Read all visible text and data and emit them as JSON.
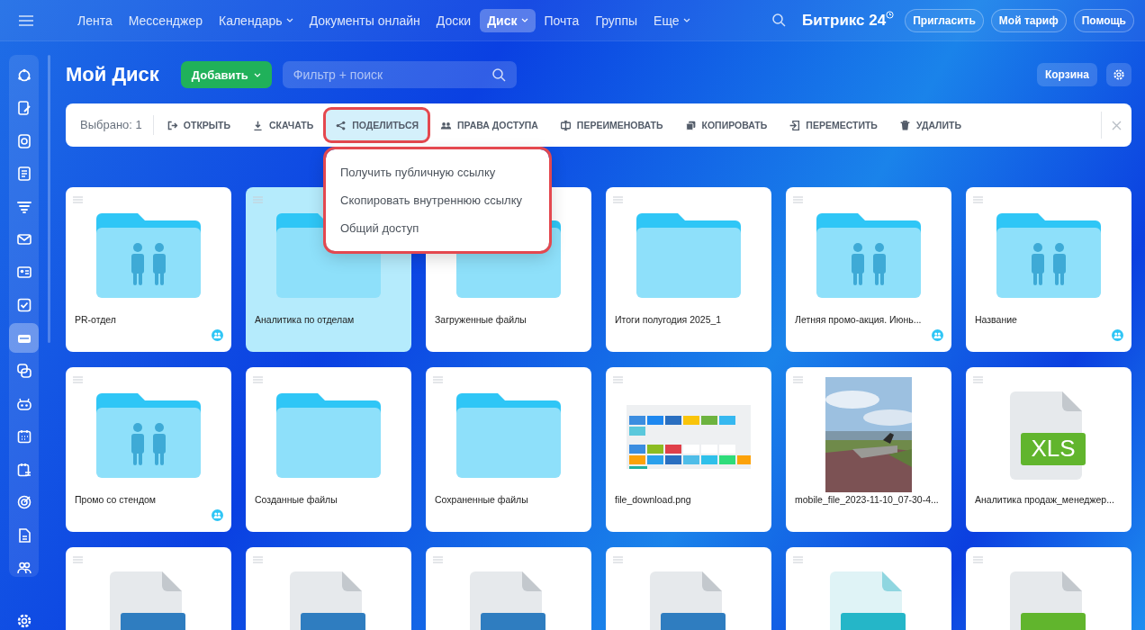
{
  "top_bar": {
    "nav": [
      {
        "label": "Лента",
        "selected": false,
        "dropdown": false
      },
      {
        "label": "Мессенджер",
        "selected": false,
        "dropdown": false
      },
      {
        "label": "Календарь",
        "selected": false,
        "dropdown": true
      },
      {
        "label": "Документы онлайн",
        "selected": false,
        "dropdown": false
      },
      {
        "label": "Доски",
        "selected": false,
        "dropdown": false
      },
      {
        "label": "Диск",
        "selected": true,
        "dropdown": true
      },
      {
        "label": "Почта",
        "selected": false,
        "dropdown": false
      },
      {
        "label": "Группы",
        "selected": false,
        "dropdown": false
      },
      {
        "label": "Еще",
        "selected": false,
        "dropdown": true
      }
    ],
    "logo": "Битрикс 24",
    "buttons": [
      "Пригласить",
      "Мой тариф",
      "Помощь"
    ]
  },
  "sidebar": {
    "items": [
      {
        "selected": false
      },
      {
        "selected": false
      },
      {
        "selected": false
      },
      {
        "selected": false
      },
      {
        "selected": false
      },
      {
        "selected": false
      },
      {
        "selected": false
      },
      {
        "selected": false
      },
      {
        "selected": true
      },
      {
        "selected": false
      },
      {
        "selected": false
      },
      {
        "selected": false
      },
      {
        "selected": false
      },
      {
        "selected": false
      },
      {
        "selected": false
      },
      {
        "selected": false
      }
    ]
  },
  "header": {
    "title": "Мой Диск",
    "add_button": "Добавить",
    "search": {
      "placeholder": "Фильтр + поиск"
    },
    "trash_button": "Корзина"
  },
  "toolbar": {
    "selected_count": "Выбрано: 1",
    "actions": [
      {
        "label": "ОТКРЫТЬ",
        "highlighted": false
      },
      {
        "label": "СКАЧАТЬ",
        "highlighted": false
      },
      {
        "label": "ПОДЕЛИТЬСЯ",
        "highlighted": true
      },
      {
        "label": "ПРАВА ДОСТУПА",
        "highlighted": false
      },
      {
        "label": "ПЕРЕИМЕНОВАТЬ",
        "highlighted": false
      },
      {
        "label": "КОПИРОВАТЬ",
        "highlighted": false
      },
      {
        "label": "ПЕРЕМЕСТИТЬ",
        "highlighted": false
      },
      {
        "label": "УДАЛИТЬ",
        "highlighted": false
      }
    ]
  },
  "share_menu": {
    "highlighted": true,
    "items": [
      "Получить публичную ссылку",
      "Скопировать внутреннюю ссылку",
      "Общий доступ"
    ]
  },
  "files": [
    {
      "kind": "shared-folder",
      "name": "PR-отдел",
      "selected": false,
      "shared": true
    },
    {
      "kind": "folder",
      "name": "Аналитика по отделам",
      "selected": true,
      "shared": false
    },
    {
      "kind": "folder",
      "name": "Загруженные файлы",
      "selected": false,
      "shared": false
    },
    {
      "kind": "folder",
      "name": "Итоги полугодия 2025_1",
      "selected": false,
      "shared": false
    },
    {
      "kind": "shared-folder",
      "name": "Летняя промо-акция. Июнь...",
      "selected": false,
      "shared": true
    },
    {
      "kind": "shared-folder",
      "name": "Название",
      "selected": false,
      "shared": true
    },
    {
      "kind": "shared-folder",
      "name": "Промо со стендом",
      "selected": false,
      "shared": true
    },
    {
      "kind": "folder",
      "name": "Созданные файлы",
      "selected": false,
      "shared": false
    },
    {
      "kind": "folder",
      "name": "Сохраненные файлы",
      "selected": false,
      "shared": false
    },
    {
      "kind": "screenshot",
      "name": "file_download.png",
      "selected": false,
      "shared": false
    },
    {
      "name": "mobile_file_2023-11-10_07-30-4...",
      "selected": false,
      "shared": false
    },
    {
      "kind": "xls",
      "name": "Аналитика продаж_менеджер...",
      "badge": "XLS",
      "selected": false,
      "shared": false
    },
    {
      "kind": "doc",
      "selected": false
    },
    {
      "kind": "doc",
      "selected": false
    },
    {
      "kind": "doc",
      "selected": false
    },
    {
      "kind": "doc",
      "selected": false
    },
    {
      "kind": "board",
      "selected": false
    },
    {
      "kind": "xls",
      "selected": false
    }
  ]
}
